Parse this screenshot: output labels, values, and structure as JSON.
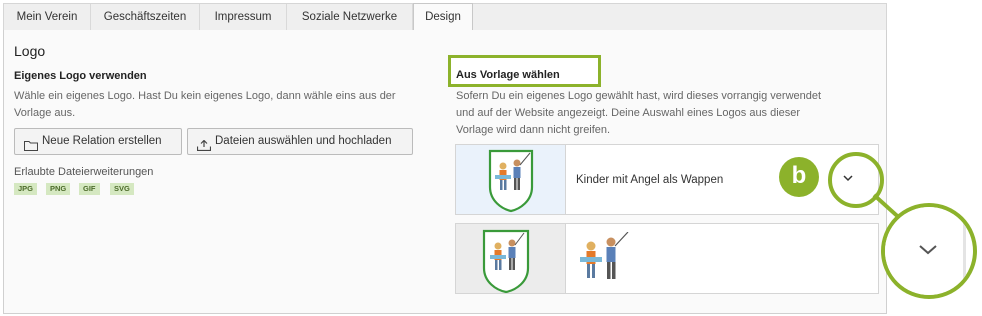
{
  "tabs": [
    {
      "label": "Mein Verein"
    },
    {
      "label": "Geschäftszeiten"
    },
    {
      "label": "Impressum"
    },
    {
      "label": "Soziale Netzwerke"
    },
    {
      "label": "Design",
      "active": true
    }
  ],
  "section_title": "Logo",
  "own_logo": {
    "title": "Eigenes Logo verwenden",
    "description_line1": "Wähle ein eigenes Logo. Hast Du kein eigenes Logo, dann wähle eins aus der",
    "description_line2": "Vorlage aus.",
    "new_relation_button": "Neue Relation erstellen",
    "upload_button": "Dateien auswählen und hochladen",
    "extensions_label": "Erlaubte Dateierweiterungen",
    "extensions": [
      "JPG",
      "PNG",
      "GIF",
      "SVG"
    ]
  },
  "template": {
    "title": "Aus Vorlage wählen",
    "description_line1": "Sofern Du ein eigenes Logo gewählt hast, wird dieses vorrangig verwendet",
    "description_line2": "und auf der Website angezeigt. Deine Auswahl eines Logos aus dieser",
    "description_line3": "Vorlage wird dann nicht greifen.",
    "selected_label": "Kinder mit Angel als Wappen"
  },
  "annotation": {
    "marker_letter": "b"
  },
  "colors": {
    "accent_green": "#8cb22b",
    "badge_bg": "#d5e8c1",
    "tab_bar_bg": "#efefef",
    "panel_bg": "#fafafa"
  },
  "icons": {
    "new_relation": "folder-icon",
    "upload": "upload-icon",
    "dropdown": "chevron-down-icon"
  }
}
